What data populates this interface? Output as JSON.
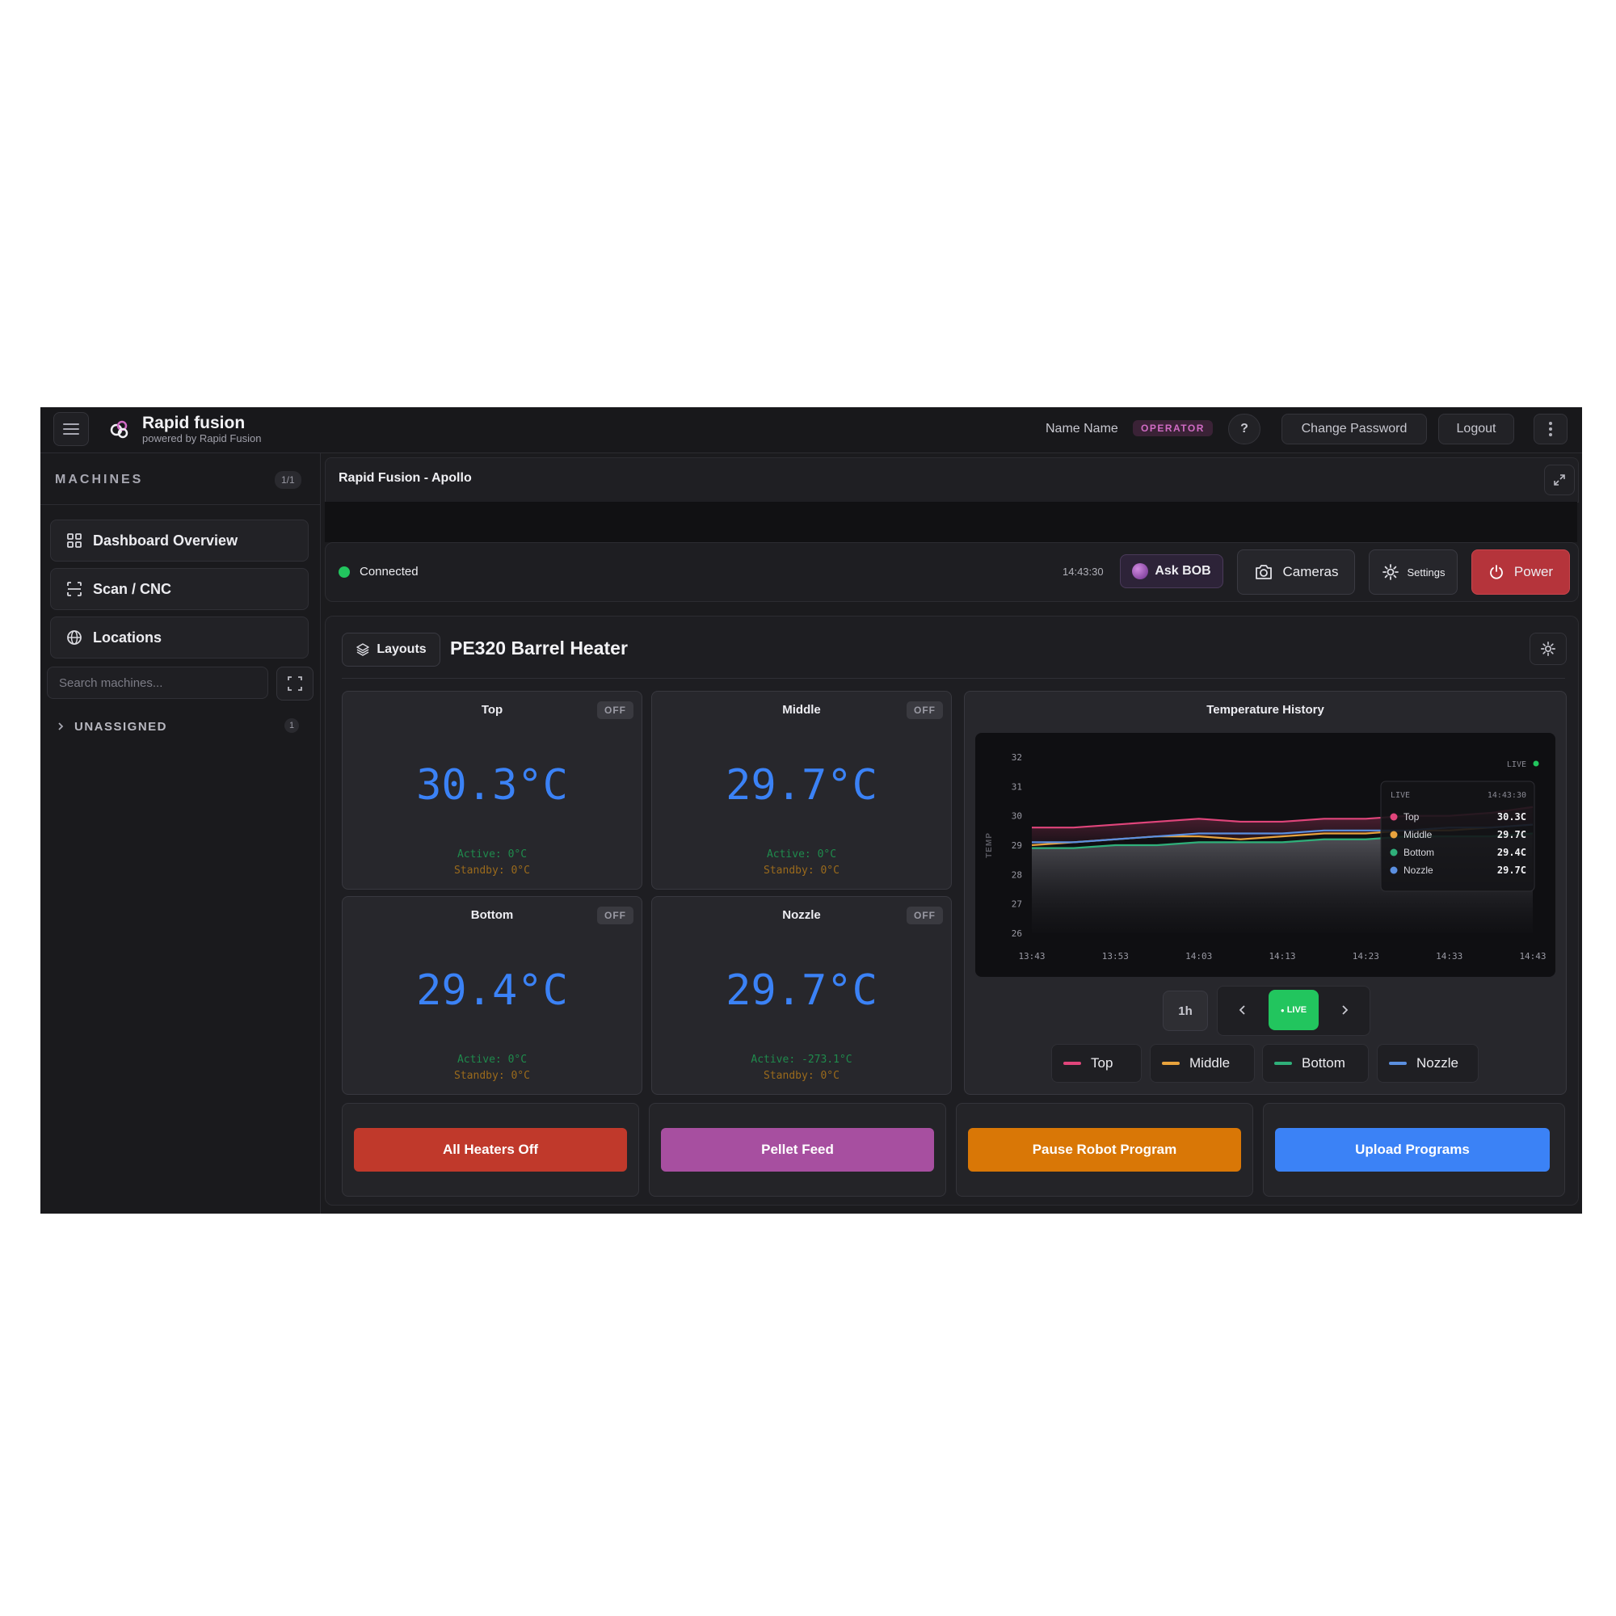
{
  "header": {
    "brand_title": "Rapid fusion",
    "brand_subtitle": "powered by Rapid Fusion",
    "user_name": "Name Name",
    "role": "OPERATOR",
    "help_label": "?",
    "change_password": "Change Password",
    "logout": "Logout"
  },
  "sidebar": {
    "heading": "MACHINES",
    "count": "1/1",
    "items": [
      {
        "label": "Dashboard Overview",
        "icon": "grid-icon"
      },
      {
        "label": "Scan / CNC",
        "icon": "scan-icon"
      },
      {
        "label": "Locations",
        "icon": "globe-icon"
      }
    ],
    "search_placeholder": "Search machines...",
    "group_label": "UNASSIGNED",
    "group_count": "1"
  },
  "panel": {
    "title": "Rapid Fusion - Apollo"
  },
  "status": {
    "connection": "Connected",
    "time": "14:43:30",
    "ask_bob": "Ask BOB",
    "cameras": "Cameras",
    "settings": "Settings",
    "power": "Power"
  },
  "section": {
    "layouts_label": "Layouts",
    "title": "PE320 Barrel Heater"
  },
  "heaters": [
    {
      "name": "Top",
      "state": "OFF",
      "temp": "30.3°C",
      "active": "Active: 0°C",
      "standby": "Standby: 0°C"
    },
    {
      "name": "Middle",
      "state": "OFF",
      "temp": "29.7°C",
      "active": "Active: 0°C",
      "standby": "Standby: 0°C"
    },
    {
      "name": "Bottom",
      "state": "OFF",
      "temp": "29.4°C",
      "active": "Active: 0°C",
      "standby": "Standby: 0°C"
    },
    {
      "name": "Nozzle",
      "state": "OFF",
      "temp": "29.7°C",
      "active": "Active: -273.1°C",
      "standby": "Standby: 0°C"
    }
  ],
  "history": {
    "title": "Temperature History",
    "range_button": "1h",
    "live_button": "LIVE",
    "live_indicator": "LIVE",
    "tooltip": {
      "label": "LIVE",
      "time": "14:43:30",
      "rows": [
        {
          "name": "Top",
          "value": "30.3C"
        },
        {
          "name": "Middle",
          "value": "29.7C"
        },
        {
          "name": "Bottom",
          "value": "29.4C"
        },
        {
          "name": "Nozzle",
          "value": "29.7C"
        }
      ]
    },
    "legend": [
      "Top",
      "Middle",
      "Bottom",
      "Nozzle"
    ]
  },
  "colors": {
    "top": "#e0457b",
    "middle": "#e8a33d",
    "bottom": "#2fb07a",
    "nozzle": "#5b8fe0",
    "temp_value": "#3b82f6",
    "live": "#22c55e"
  },
  "chart_data": {
    "type": "line",
    "title": "Temperature History",
    "xlabel": "",
    "ylabel": "TEMP",
    "x_ticks": [
      "13:43",
      "13:53",
      "14:03",
      "14:13",
      "14:23",
      "14:33",
      "14:43"
    ],
    "y_ticks": [
      26,
      27,
      28,
      29,
      30,
      31,
      32
    ],
    "ylim": [
      26,
      32
    ],
    "grid": false,
    "legend": "tooltip at top-right",
    "x": [
      "13:43",
      "13:48",
      "13:53",
      "13:58",
      "14:03",
      "14:08",
      "14:13",
      "14:18",
      "14:23",
      "14:28",
      "14:33",
      "14:38",
      "14:43"
    ],
    "series": [
      {
        "name": "Top",
        "values": [
          29.6,
          29.6,
          29.7,
          29.8,
          29.9,
          29.8,
          29.8,
          29.9,
          29.9,
          30.0,
          30.0,
          30.1,
          30.3
        ]
      },
      {
        "name": "Middle",
        "values": [
          29.0,
          29.1,
          29.2,
          29.3,
          29.3,
          29.2,
          29.3,
          29.4,
          29.4,
          29.5,
          29.5,
          29.6,
          29.7
        ]
      },
      {
        "name": "Bottom",
        "values": [
          28.9,
          28.9,
          29.0,
          29.0,
          29.1,
          29.1,
          29.1,
          29.2,
          29.2,
          29.3,
          29.3,
          29.3,
          29.4
        ]
      },
      {
        "name": "Nozzle",
        "values": [
          29.1,
          29.1,
          29.2,
          29.3,
          29.4,
          29.4,
          29.4,
          29.5,
          29.5,
          29.5,
          29.6,
          29.6,
          29.7
        ]
      }
    ]
  },
  "actions": [
    {
      "label": "All Heaters Off",
      "color": "#c0392b"
    },
    {
      "label": "Pellet Feed",
      "color": "#a74fa0"
    },
    {
      "label": "Pause Robot Program",
      "color": "#d97706"
    },
    {
      "label": "Upload Programs",
      "color": "#3b82f6"
    }
  ]
}
